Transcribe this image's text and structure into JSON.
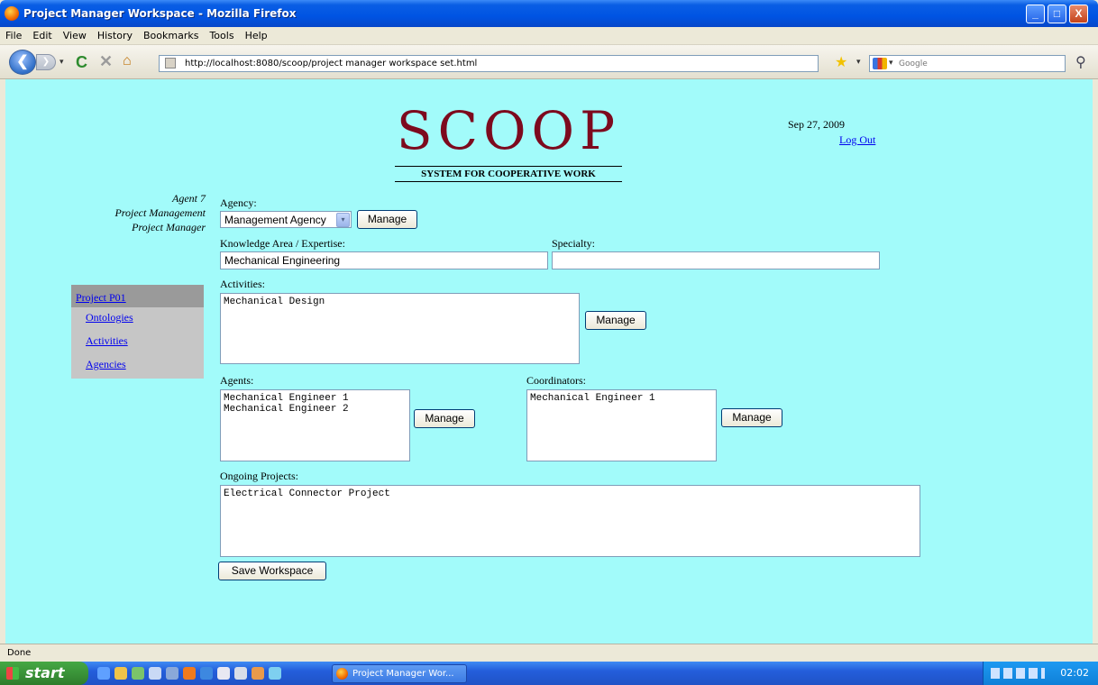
{
  "window": {
    "title": "Project Manager Workspace - Mozilla Firefox",
    "buttons": {
      "minimize": "_",
      "maximize": "□",
      "close": "X"
    }
  },
  "menu": {
    "items": [
      "File",
      "Edit",
      "View",
      "History",
      "Bookmarks",
      "Tools",
      "Help"
    ]
  },
  "nav": {
    "url": "http://localhost:8080/scoop/project manager workspace set.html",
    "search_placeholder": "Google",
    "back_glyph": "❮",
    "forward_glyph": "❯",
    "reload_glyph": "C",
    "stop_glyph": "✕",
    "home_glyph": "⌂",
    "star_glyph": "★",
    "search_glyph": "⚲",
    "dropdown_glyph": "▾"
  },
  "header": {
    "logo": "SCOOP",
    "logo_subtitle": "SYSTEM FOR COOPERATIVE WORK",
    "date": "Sep 27, 2009",
    "logout": "Log Out"
  },
  "user": {
    "name": "Agent 7",
    "department": "Project Management",
    "role": "Project Manager"
  },
  "sidebar": {
    "project": "Project P01",
    "items": [
      "Ontologies",
      "Activities",
      "Agencies"
    ]
  },
  "form": {
    "agency_label": "Agency:",
    "agency_value": "Management Agency",
    "manage_label": "Manage",
    "knowledge_label": "Knowledge Area / Expertise:",
    "knowledge_value": "Mechanical Engineering",
    "specialty_label": "Specialty:",
    "specialty_value": "",
    "activities_label": "Activities:",
    "activities_value": "Mechanical Design",
    "agents_label": "Agents:",
    "agents_value": "Mechanical Engineer 1\nMechanical Engineer 2",
    "coordinators_label": "Coordinators:",
    "coordinators_value": "Mechanical Engineer 1",
    "ongoing_label": "Ongoing Projects:",
    "ongoing_value": "Electrical Connector Project",
    "save_label": "Save Workspace"
  },
  "status": {
    "text": "Done"
  },
  "taskbar": {
    "start": "start",
    "task": "Project Manager Wor...",
    "clock": "02:02"
  }
}
